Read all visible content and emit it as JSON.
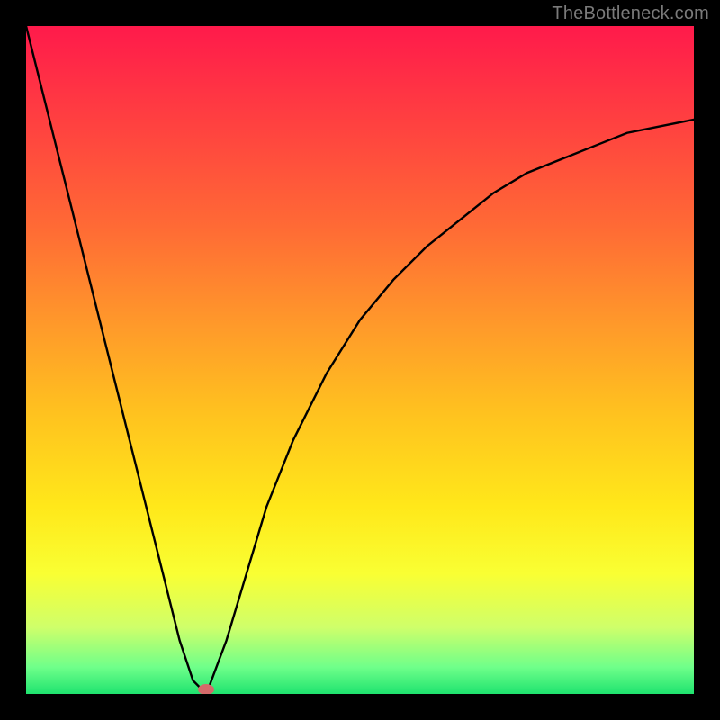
{
  "watermark": "TheBottleneck.com",
  "chart_data": {
    "type": "line",
    "title": "",
    "xlabel": "",
    "ylabel": "",
    "xlim": [
      0,
      100
    ],
    "ylim": [
      0,
      100
    ],
    "grid": false,
    "legend": false,
    "series": [
      {
        "name": "curve",
        "x": [
          0,
          5,
          10,
          15,
          18,
          21,
          23,
          25,
          27,
          30,
          33,
          36,
          40,
          45,
          50,
          55,
          60,
          65,
          70,
          75,
          80,
          85,
          90,
          95,
          100
        ],
        "values": [
          100,
          80,
          60,
          40,
          28,
          16,
          8,
          2,
          0,
          8,
          18,
          28,
          38,
          48,
          56,
          62,
          67,
          71,
          75,
          78,
          80,
          82,
          84,
          85,
          86
        ]
      }
    ],
    "annotations": [
      {
        "name": "min-point-dot",
        "x": 27,
        "y": 0
      }
    ],
    "background_gradient": {
      "direction": "vertical",
      "stops": [
        {
          "pos": 0,
          "color": "#ff1a4b"
        },
        {
          "pos": 30,
          "color": "#ff6a35"
        },
        {
          "pos": 58,
          "color": "#ffc21f"
        },
        {
          "pos": 82,
          "color": "#f9ff33"
        },
        {
          "pos": 100,
          "color": "#1fe36f"
        }
      ]
    }
  }
}
